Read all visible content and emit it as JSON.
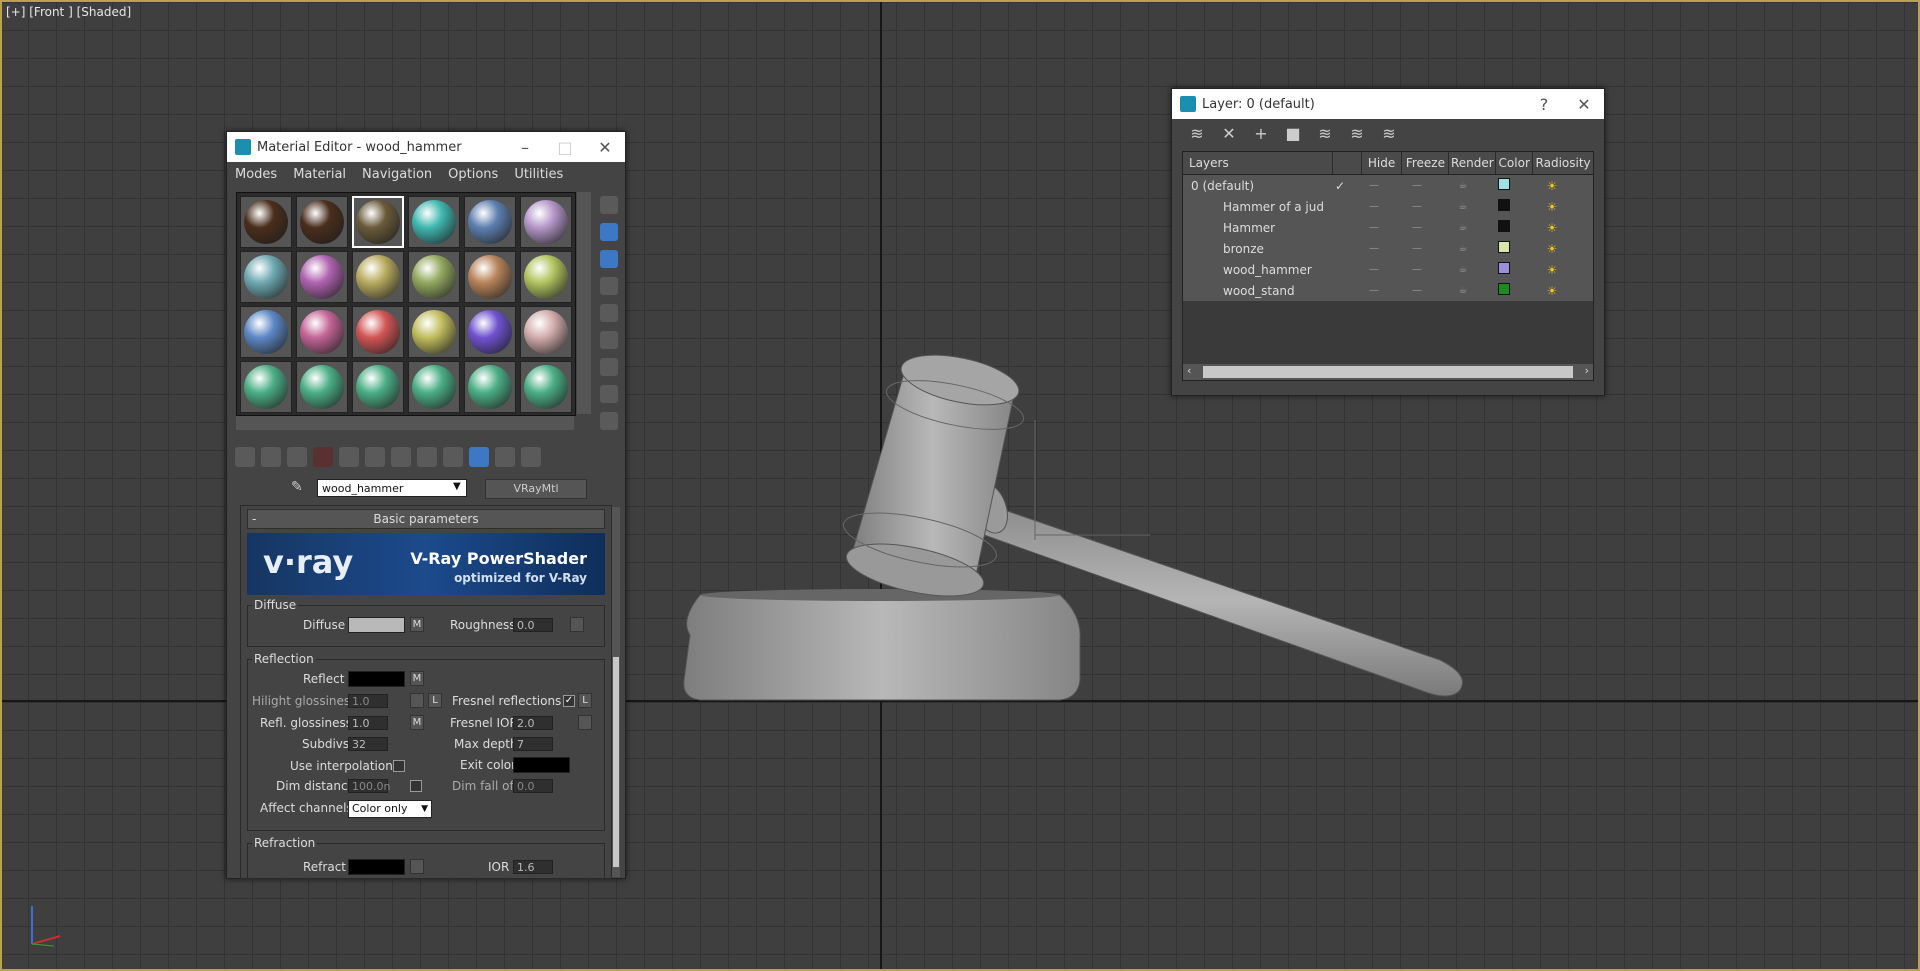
{
  "viewport": {
    "label": "[+] [Front ] [Shaded]"
  },
  "material_editor": {
    "title": "Material Editor - wood_hammer",
    "menu": [
      "Modes",
      "Material",
      "Navigation",
      "Options",
      "Utilities"
    ],
    "slot_colors": [
      "#4a2e1c",
      "#4a2e1c",
      "#6a5a3a",
      "#3fb7b0",
      "#5e7fb0",
      "#b497c9",
      "#6fa9b2",
      "#b063b0",
      "#b8ab60",
      "#93a85f",
      "#b7835a",
      "#b1c460",
      "#5d88c6",
      "#c36596",
      "#d25555",
      "#c1bd5e",
      "#6f52d0",
      "#d2acac",
      "#4caf86",
      "#4caf86",
      "#4caf86",
      "#4caf86",
      "#4caf86",
      "#4caf86"
    ],
    "material_name": "wood_hammer",
    "material_type": "VRayMtl",
    "rollout_title": "Basic parameters",
    "banner": {
      "logo": "v·ray",
      "headline": "V-Ray PowerShader",
      "sub": "optimized for V-Ray"
    },
    "diffuse": {
      "group": "Diffuse",
      "label": "Diffuse",
      "m": "M",
      "roughness_label": "Roughness",
      "roughness": "0.0"
    },
    "reflection": {
      "group": "Reflection",
      "reflect_label": "Reflect",
      "m": "M",
      "hilight_label": "Hilight glossiness",
      "hilight": "1.0",
      "l": "L",
      "fresnel_label": "Fresnel reflections",
      "refl_gloss_label": "Refl. glossiness",
      "refl_gloss": "1.0",
      "fresnel_ior_label": "Fresnel IOR",
      "fresnel_ior": "2.0",
      "subdivs_label": "Subdivs",
      "subdivs": "32",
      "max_depth_label": "Max depth",
      "max_depth": "7",
      "use_interp_label": "Use interpolation",
      "exit_color_label": "Exit color",
      "dim_distance_label": "Dim distance",
      "dim_distance": "100.0n",
      "dim_falloff_label": "Dim fall off",
      "dim_falloff": "0.0",
      "affect_label": "Affect channels",
      "affect_value": "Color only"
    },
    "refraction": {
      "group": "Refraction",
      "refract_label": "Refract",
      "ior_label": "IOR",
      "ior": "1.6"
    }
  },
  "layer_dialog": {
    "title": "Layer: 0 (default)",
    "help": "?",
    "columns": [
      "Layers",
      "Hide",
      "Freeze",
      "Render",
      "Color",
      "Radiosity"
    ],
    "rows": [
      {
        "name": "0 (default)",
        "color": "#9fe3e3",
        "current": true
      },
      {
        "name": "Hammer of a jud",
        "color": "#111111",
        "current": false
      },
      {
        "name": "Hammer",
        "color": "#111111",
        "current": false
      },
      {
        "name": "bronze",
        "color": "#d8e6a8",
        "current": false
      },
      {
        "name": "wood_hammer",
        "color": "#9a8fd8",
        "current": false
      },
      {
        "name": "wood_stand",
        "color": "#1d8a1d",
        "current": false
      }
    ],
    "checkmark": "✓"
  }
}
